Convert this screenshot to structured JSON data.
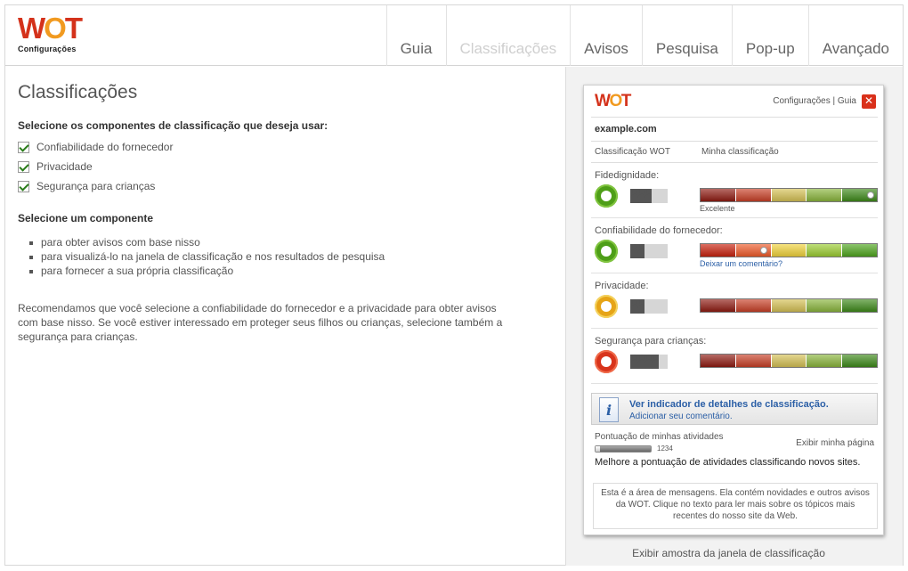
{
  "header": {
    "logo": {
      "w": "W",
      "o": "O",
      "t": "T",
      "subtitle": "Configurações"
    },
    "tabs": [
      {
        "label": "Guia",
        "active": false
      },
      {
        "label": "Classificações",
        "active": true
      },
      {
        "label": "Avisos",
        "active": false
      },
      {
        "label": "Pesquisa",
        "active": false
      },
      {
        "label": "Pop-up",
        "active": false
      },
      {
        "label": "Avançado",
        "active": false
      }
    ]
  },
  "main": {
    "title": "Classificações",
    "select_components_heading": "Selecione os componentes de classificação que deseja usar:",
    "checkboxes": [
      {
        "label": "Confiabilidade do fornecedor",
        "checked": true
      },
      {
        "label": "Privacidade",
        "checked": true
      },
      {
        "label": "Segurança para crianças",
        "checked": true
      }
    ],
    "select_one_heading": "Selecione um componente",
    "bullets": [
      "para obter avisos com base nisso",
      "para visualizá-lo na janela de classificação e nos resultados de pesquisa",
      "para fornecer a sua própria classificação"
    ],
    "recommendation": "Recomendamos que você selecione a confiabilidade do fornecedor e a privacidade para obter avisos com base nisso. Se você estiver interessado em proteger seus filhos ou crianças, selecione também a segurança para crianças."
  },
  "popup": {
    "logo": {
      "w": "W",
      "o": "O",
      "t": "T"
    },
    "links": "Configurações | Guia",
    "close_symbol": "✕",
    "domain": "example.com",
    "col_wot": "Classificação WOT",
    "col_mine": "Minha classificação",
    "components": [
      {
        "title": "Fidedignidade:",
        "ring": "green",
        "people": 3,
        "my_rating_level": 5,
        "note": "Excelente",
        "note_type": "grey"
      },
      {
        "title": "Confiabilidade do fornecedor:",
        "ring": "green",
        "people": 2,
        "my_rating_level": 2,
        "note": "Deixar um comentário?",
        "note_type": "link"
      },
      {
        "title": "Privacidade:",
        "ring": "yellow",
        "people": 2,
        "my_rating_level": 0,
        "note": "",
        "note_type": "grey"
      },
      {
        "title": "Segurança para crianças:",
        "ring": "red",
        "people": 4,
        "my_rating_level": 0,
        "note": "",
        "note_type": "grey"
      }
    ],
    "info": {
      "icon": "i",
      "title": "Ver indicador de detalhes de classificação.",
      "link": "Adicionar seu comentário."
    },
    "activity": {
      "label": "Pontuação de minhas atividades",
      "page_link": "Exibir minha página",
      "score": "1234",
      "score_fraction": 0.08,
      "improve": "Melhore a pontuação de atividades classificando novos sites."
    },
    "message": "Esta é a área de mensagens. Ela contém novidades e outros avisos da WOT. Clique no texto para ler mais sobre os tópicos mais recentes do nosso site da Web."
  },
  "preview_link": "Exibir amostra da janela de classificação",
  "colors": {
    "bar_segments": [
      "#8f1b12",
      "#c84027",
      "#d5c155",
      "#8ab53c",
      "#3e8a1a"
    ],
    "bar_segments_vivid": [
      "#c8220e",
      "#ef5b2a",
      "#f1d33b",
      "#9ccd32",
      "#4fa61e"
    ],
    "link": "#2b5fa6"
  }
}
